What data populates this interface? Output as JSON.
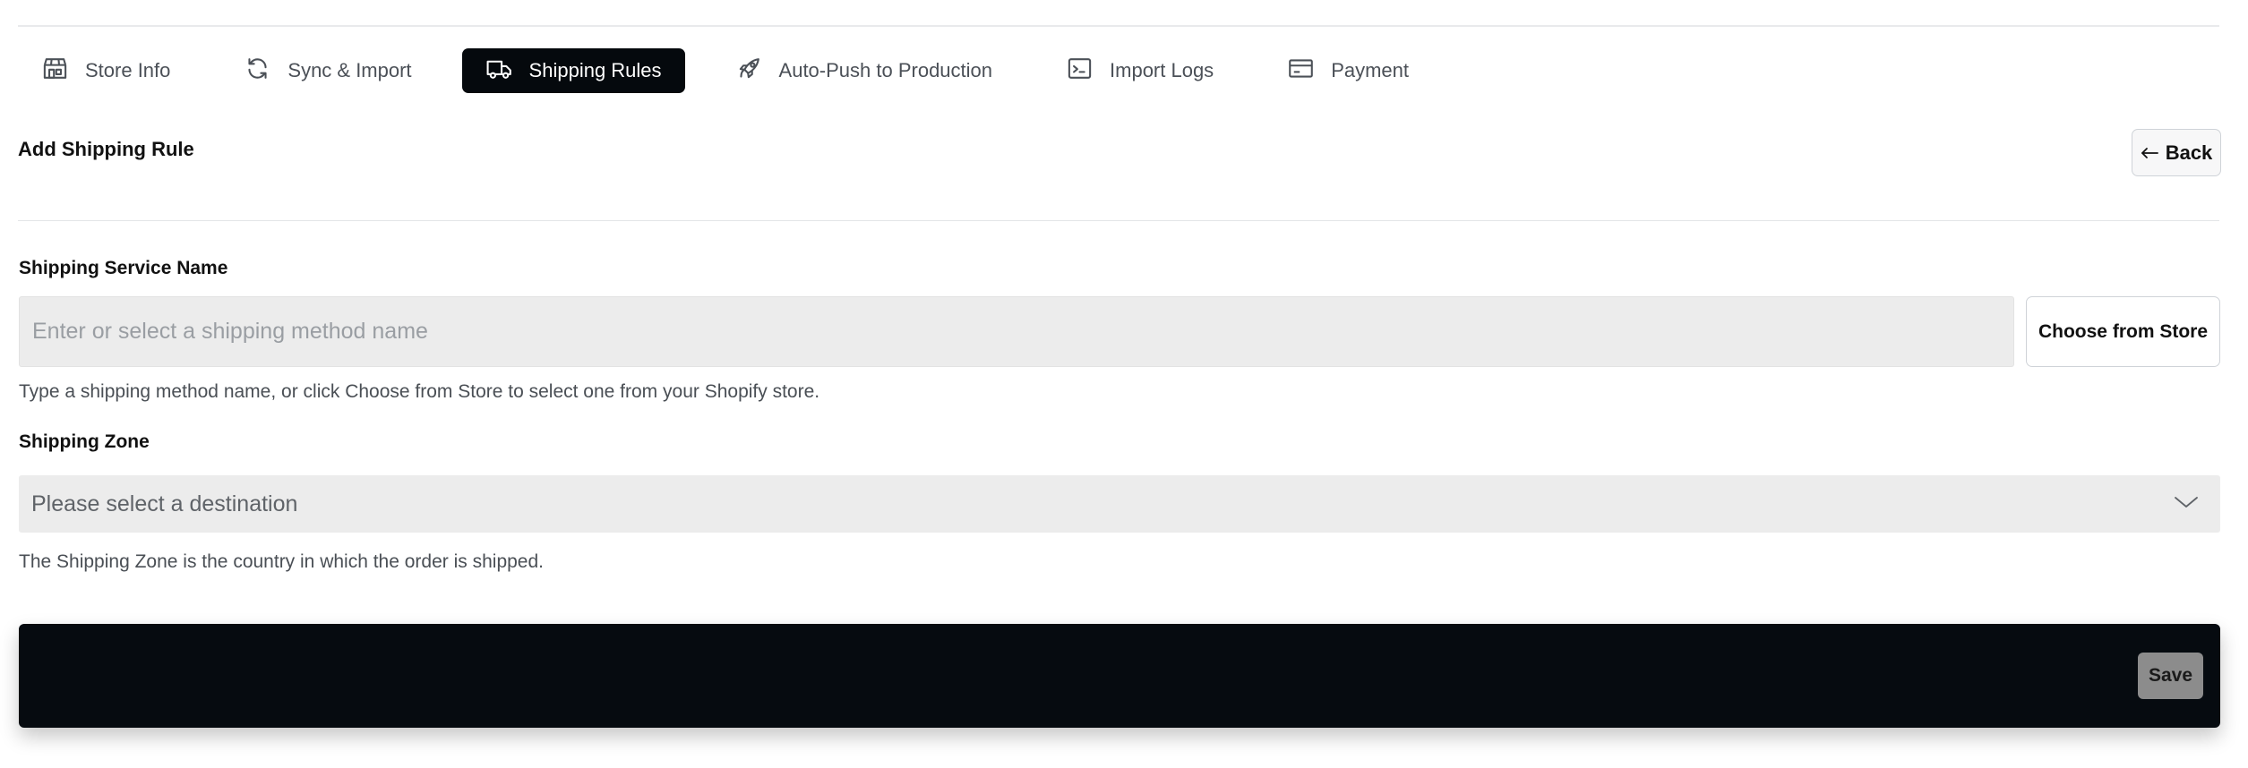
{
  "tabs": [
    {
      "label": "Store Info",
      "icon": "store-icon",
      "active": false
    },
    {
      "label": "Sync & Import",
      "icon": "refresh-icon",
      "active": false
    },
    {
      "label": "Shipping Rules",
      "icon": "truck-icon",
      "active": true
    },
    {
      "label": "Auto-Push to Production",
      "icon": "rocket-icon",
      "active": false
    },
    {
      "label": "Import Logs",
      "icon": "terminal-icon",
      "active": false
    },
    {
      "label": "Payment",
      "icon": "credit-card-icon",
      "active": false
    }
  ],
  "page": {
    "title": "Add Shipping Rule",
    "back_label": "Back",
    "back_icon": "arrow-left-icon"
  },
  "shipping_service": {
    "label": "Shipping Service Name",
    "value": "",
    "placeholder": "Enter or select a shipping method name",
    "choose_label": "Choose from Store",
    "help": "Type a shipping method name, or click Choose from Store to select one from your Shopify store."
  },
  "shipping_zone": {
    "label": "Shipping Zone",
    "selected": "Please select a destination",
    "icon": "chevron-down-icon",
    "help": "The Shipping Zone is the country in which the order is shipped."
  },
  "save_bar": {
    "save_label": "Save"
  },
  "colors": {
    "active_tab_bg": "#05090d",
    "save_bar_bg": "#060b10",
    "input_bg": "#ececec",
    "save_button_bg": "#8c8c8c"
  }
}
